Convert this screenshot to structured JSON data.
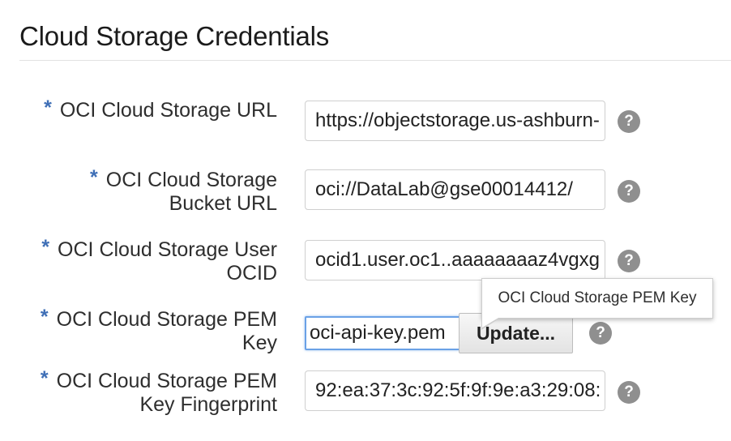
{
  "section": {
    "title": "Cloud Storage Credentials"
  },
  "required_marker": "*",
  "fields": [
    {
      "label": "OCI Cloud Storage URL",
      "value": "https://objectstorage.us-ashburn-"
    },
    {
      "label_line1": "OCI Cloud Storage",
      "label_line2": "Bucket URL",
      "value": "oci://DataLab@gse00014412/"
    },
    {
      "label_line1": "OCI Cloud Storage User",
      "label_line2": "OCID",
      "value": "ocid1.user.oc1..aaaaaaaaz4vgxg"
    },
    {
      "label_line1": "OCI Cloud Storage PEM",
      "label_line2": "Key",
      "value": "oci-api-key.pem",
      "button": "Update..."
    },
    {
      "label_line1": "OCI Cloud Storage PEM",
      "label_line2": "Key Fingerprint",
      "value": "92:ea:37:3c:92:5f:9f:9e:a3:29:08:"
    }
  ],
  "help_glyph": "?",
  "tooltip": {
    "text": "OCI Cloud Storage PEM Key"
  },
  "colors": {
    "required": "#3f6fb6",
    "focus_border": "#6aa1e6",
    "help_icon": "#8f8f8f"
  }
}
